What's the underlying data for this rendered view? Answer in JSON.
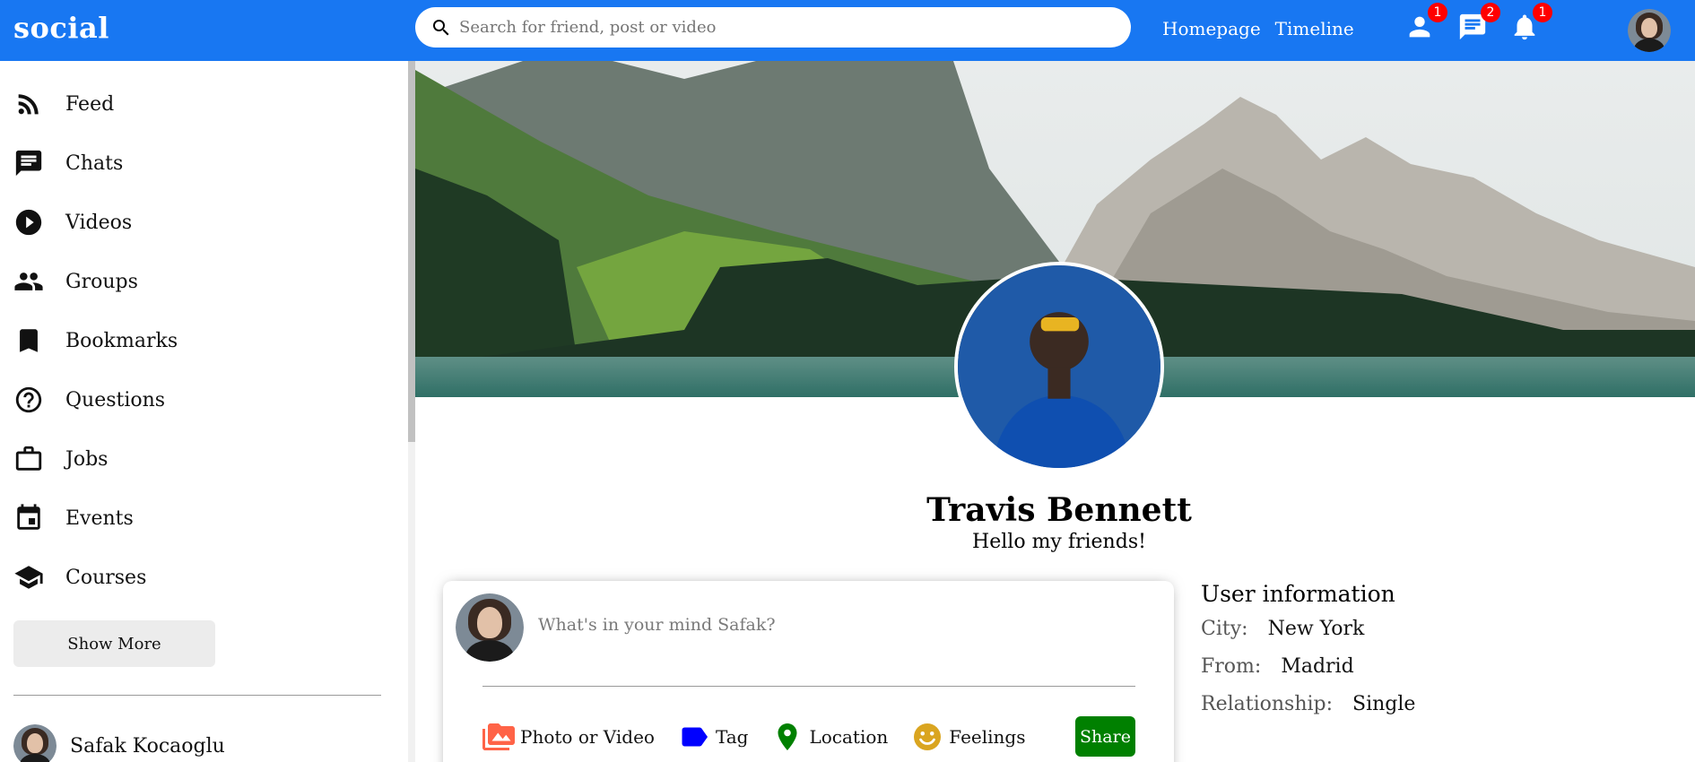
{
  "topbar": {
    "logo": "social",
    "search_placeholder": "Search for friend, post or video",
    "links": [
      "Homepage",
      "Timeline"
    ],
    "badges": {
      "friends": "1",
      "messages": "2",
      "notifications": "1"
    },
    "color": "#1877f2"
  },
  "sidebar": {
    "items": [
      {
        "label": "Feed",
        "icon": "rss-feed-icon"
      },
      {
        "label": "Chats",
        "icon": "chat-icon"
      },
      {
        "label": "Videos",
        "icon": "play-circle-icon"
      },
      {
        "label": "Groups",
        "icon": "group-icon"
      },
      {
        "label": "Bookmarks",
        "icon": "bookmark-icon"
      },
      {
        "label": "Questions",
        "icon": "help-circle-icon"
      },
      {
        "label": "Jobs",
        "icon": "work-icon"
      },
      {
        "label": "Events",
        "icon": "event-icon"
      },
      {
        "label": "Courses",
        "icon": "school-icon"
      }
    ],
    "show_more": "Show More",
    "friends": [
      {
        "name": "Safak Kocaoglu"
      }
    ]
  },
  "profile": {
    "name": "Travis Bennett",
    "description": "Hello my friends!"
  },
  "share": {
    "placeholder": "What's in your mind Safak?",
    "options": [
      {
        "label": "Photo or Video",
        "icon": "perm-media-icon",
        "color": "#ff6347"
      },
      {
        "label": "Tag",
        "icon": "label-icon",
        "color": "#0000ff"
      },
      {
        "label": "Location",
        "icon": "room-icon",
        "color": "#008000"
      },
      {
        "label": "Feelings",
        "icon": "emoji-icon",
        "color": "#daa520"
      }
    ],
    "button": "Share",
    "button_color": "#008000"
  },
  "user_info": {
    "title": "User information",
    "rows": [
      {
        "key": "City:",
        "value": "New York"
      },
      {
        "key": "From:",
        "value": "Madrid"
      },
      {
        "key": "Relationship:",
        "value": "Single"
      }
    ]
  }
}
